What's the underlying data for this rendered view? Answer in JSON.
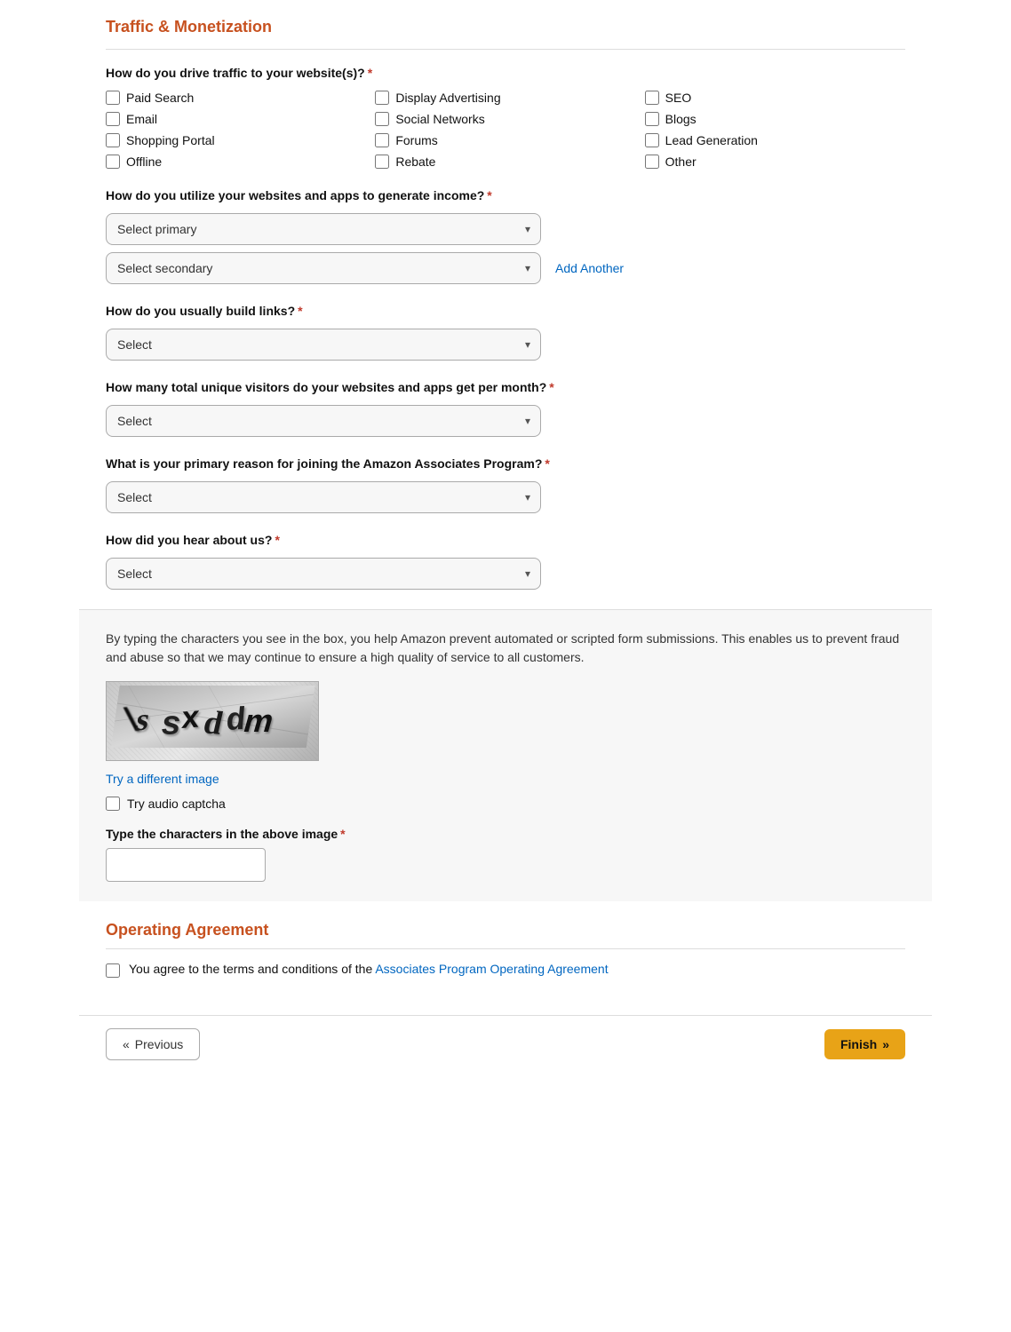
{
  "page": {
    "section_title": "Traffic & Monetization",
    "traffic_question": "How do you drive traffic to your website(s)?",
    "traffic_options": [
      {
        "id": "paid_search",
        "label": "Paid Search"
      },
      {
        "id": "display_advertising",
        "label": "Display Advertising"
      },
      {
        "id": "seo",
        "label": "SEO"
      },
      {
        "id": "email",
        "label": "Email"
      },
      {
        "id": "social_networks",
        "label": "Social Networks"
      },
      {
        "id": "blogs",
        "label": "Blogs"
      },
      {
        "id": "shopping_portal",
        "label": "Shopping Portal"
      },
      {
        "id": "forums",
        "label": "Forums"
      },
      {
        "id": "lead_generation",
        "label": "Lead Generation"
      },
      {
        "id": "offline",
        "label": "Offline"
      },
      {
        "id": "rebate",
        "label": "Rebate"
      },
      {
        "id": "other",
        "label": "Other"
      }
    ],
    "income_question": "How do you utilize your websites and apps to generate income?",
    "income_select_primary_placeholder": "Select primary",
    "income_select_secondary_placeholder": "Select secondary",
    "add_another_label": "Add Another",
    "build_links_question": "How do you usually build links?",
    "build_links_placeholder": "Select",
    "visitors_question": "How many total unique visitors do your websites and apps get per month?",
    "visitors_placeholder": "Select",
    "join_reason_question": "What is your primary reason for joining the Amazon Associates Program?",
    "join_reason_placeholder": "Select",
    "hear_about_question": "How did you hear about us?",
    "hear_about_placeholder": "Select",
    "captcha_desc": "By typing the characters you see in the box, you help Amazon prevent automated or scripted form submissions. This enables us to prevent fraud and abuse so that we may continue to ensure a high quality of service to all customers.",
    "captcha_text": "ssxddm",
    "captcha_try_diff": "Try a different image",
    "captcha_audio_label": "Try audio captcha",
    "captcha_input_label": "Type the characters in the above image",
    "operating_title": "Operating Agreement",
    "operating_agreement_text": "You agree to the terms and conditions of the ",
    "operating_agreement_link_text": "Associates Program Operating Agreement",
    "btn_previous": "Previous",
    "btn_finish": "Finish",
    "chevron": "▾",
    "previous_icon": "«",
    "finish_icon": "»"
  }
}
